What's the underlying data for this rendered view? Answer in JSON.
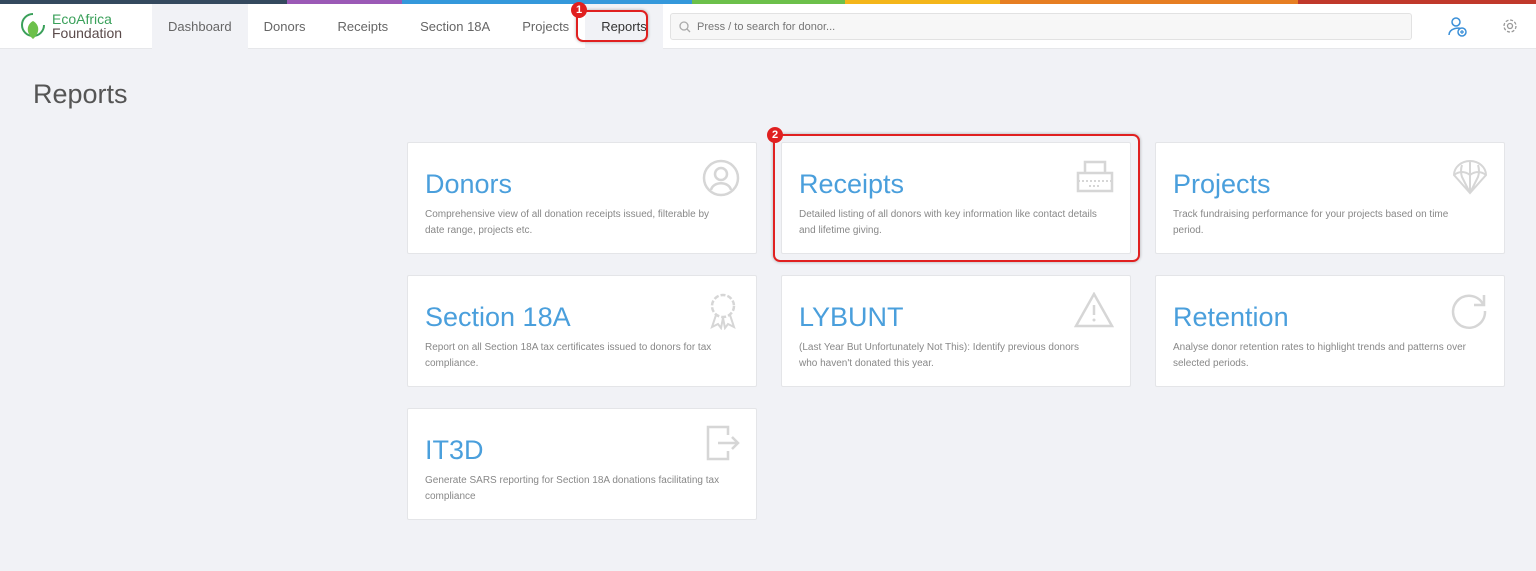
{
  "brand": {
    "line1": "EcoAfrica",
    "line2": "Foundation"
  },
  "colors": {
    "accent": "#4a9fdc",
    "highlight": "#e02020",
    "topbar": [
      "#34495e",
      "#9b59b6",
      "#3498db",
      "#2ecc71",
      "#f1c40f",
      "#e67e22",
      "#c0392b"
    ]
  },
  "nav": {
    "items": [
      {
        "label": "Dashboard"
      },
      {
        "label": "Donors"
      },
      {
        "label": "Receipts"
      },
      {
        "label": "Section 18A"
      },
      {
        "label": "Projects"
      },
      {
        "label": "Reports",
        "active": true
      }
    ]
  },
  "search": {
    "placeholder": "Press / to search for donor..."
  },
  "header_icons": [
    "add-user-icon",
    "gear-icon"
  ],
  "annotations": [
    "1",
    "2"
  ],
  "page_title": "Reports",
  "cards": [
    {
      "title": "Donors",
      "desc": "Comprehensive view of all donation receipts issued, filterable by date range, projects etc.",
      "icon": "user-circle-icon"
    },
    {
      "title": "Receipts",
      "desc": "Detailed listing of all donors with key information like contact details and lifetime giving.",
      "icon": "printer-receipt-icon"
    },
    {
      "title": "Projects",
      "desc": "Track fundraising performance for your projects based on time period.",
      "icon": "globe-icon"
    },
    {
      "title": "Section 18A",
      "desc": "Report on all Section 18A tax certificates issued to donors for tax compliance.",
      "icon": "award-icon"
    },
    {
      "title": "LYBUNT",
      "desc": "(Last Year But Unfortunately Not This): Identify previous donors who haven't donated this year.",
      "icon": "warning-icon"
    },
    {
      "title": "Retention",
      "desc": "Analyse donor retention rates to highlight trends and patterns over selected periods.",
      "icon": "refresh-icon"
    },
    {
      "title": "IT3D",
      "desc": "Generate SARS reporting for Section 18A donations facilitating tax compliance",
      "icon": "export-icon"
    }
  ]
}
